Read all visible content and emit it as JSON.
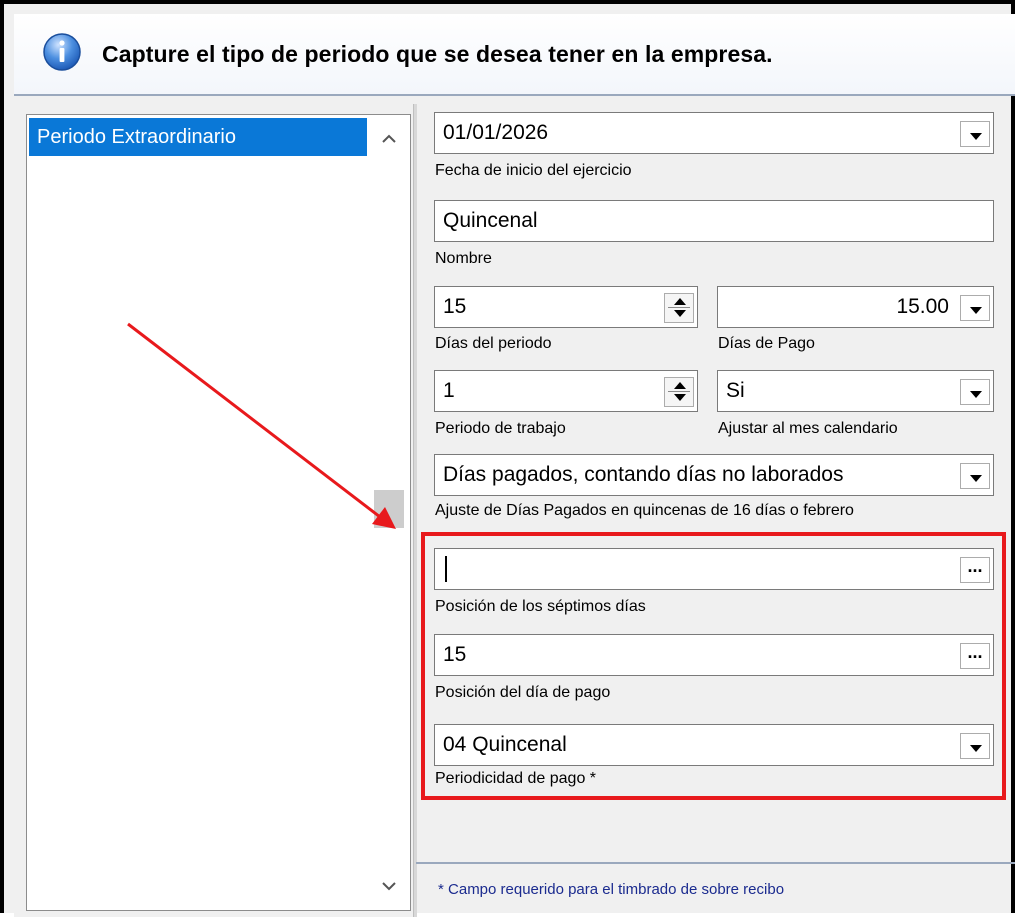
{
  "header": {
    "icon": "info-icon",
    "title": "Capture el tipo de periodo que se desea tener en la empresa."
  },
  "period_list": {
    "items": [
      "Periodo Extraordinario"
    ],
    "selected": "Periodo Extraordinario"
  },
  "form": {
    "fecha_inicio": {
      "value": "01/01/2026",
      "label": "Fecha de inicio del ejercicio"
    },
    "nombre": {
      "value": "Quincenal",
      "label": "Nombre"
    },
    "dias_periodo": {
      "value": "15",
      "label": "Días del periodo"
    },
    "dias_pago": {
      "value": "15.00",
      "label": "Días de Pago"
    },
    "periodo_trabajo": {
      "value": "1",
      "label": "Periodo de trabajo"
    },
    "ajustar_mes": {
      "value": "Si",
      "label": "Ajustar al mes calendario"
    },
    "ajuste_dias_pagados": {
      "value": "Días pagados, contando días no laborados",
      "label": "Ajuste de Días Pagados en quincenas de 16 días o febrero"
    },
    "posicion_septimos": {
      "value": "",
      "label": "Posición de los séptimos días"
    },
    "posicion_dia_pago": {
      "value": "15",
      "label": "Posición del día de pago"
    },
    "periodicidad_pago": {
      "value": "04 Quincenal",
      "label": "Periodicidad de pago *"
    }
  },
  "footer": {
    "star": "*",
    "note": "Campo requerido para el timbrado de sobre recibo"
  },
  "ellipsis": "...",
  "colors": {
    "selection": "#0a78d7",
    "highlight": "#e8191c",
    "arrow": "#e8191c",
    "footer_text": "#1b2b8f"
  }
}
